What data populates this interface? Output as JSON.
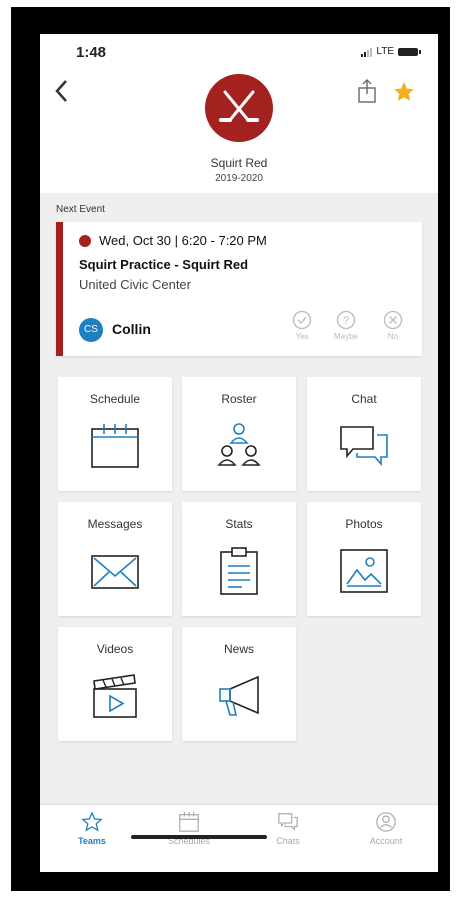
{
  "status": {
    "time": "1:48",
    "network": "LTE"
  },
  "team": {
    "name": "Squirt Red",
    "season": "2019-2020"
  },
  "next_event": {
    "section_label": "Next Event",
    "date": "Wed, Oct 30 | 6:20 - 7:20 PM",
    "title": "Squirt Practice - Squirt Red",
    "location": "United Civic Center",
    "person_initials": "CS",
    "person_name": "Collin",
    "rsvp": [
      "Yes",
      "Maybe",
      "No"
    ]
  },
  "tiles": [
    {
      "label": "Schedule",
      "icon": "calendar-icon"
    },
    {
      "label": "Roster",
      "icon": "roster-icon"
    },
    {
      "label": "Chat",
      "icon": "chat-icon"
    },
    {
      "label": "Messages",
      "icon": "envelope-icon"
    },
    {
      "label": "Stats",
      "icon": "clipboard-icon"
    },
    {
      "label": "Photos",
      "icon": "photo-icon"
    },
    {
      "label": "Videos",
      "icon": "clapperboard-icon"
    },
    {
      "label": "News",
      "icon": "megaphone-icon"
    }
  ],
  "tabs": [
    {
      "label": "Teams",
      "active": true
    },
    {
      "label": "Schedules",
      "active": false
    },
    {
      "label": "Chats",
      "active": false
    },
    {
      "label": "Account",
      "active": false
    }
  ],
  "colors": {
    "brand": "#a3211f",
    "accent": "#1e7fc1",
    "star": "#f2b01e"
  }
}
